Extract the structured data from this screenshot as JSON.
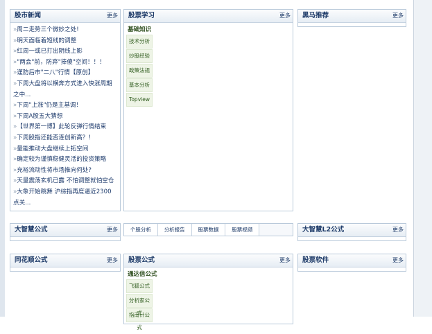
{
  "more_label": "更多",
  "panels": {
    "news": {
      "title": "股市新闻",
      "items": [
        "周二走势三个微妙之处!",
        "明天面临着短线的调整",
        "红周一或已打出阴线上影",
        "\"两会\"前，防弃\"捧傻\"空间！！！",
        "谨防后市\"二八\"行情【原创】",
        "下周大盘将以横奔方式进入快涨周期之中...",
        "下周\"上涨\"仍是主基调！",
        "下周A股五大猜想",
        "【世界第一博】此轮反弹行情结束",
        "下周股指还能否连创新高？！",
        "量能推动大盘继续上拓空间",
        "确定较为谨慎稳健灵活的投资策略",
        "充裕流动性将市场推向何处?",
        "天量震荡玄机已露 不怕调整就怕空仓",
        "大象开始跳舞 沪综指再度逼近2300点关..."
      ]
    },
    "learning": {
      "title": "股票学习",
      "sub_head": "基础知识",
      "items": [
        "技术分析",
        "炒股经验",
        "政策法规",
        "基本分析",
        "Topview"
      ]
    },
    "darkhorse": {
      "title": "黑马推荐"
    },
    "dazhihui": {
      "title": "大智慧公式"
    },
    "dazhihui_l2": {
      "title": "大智慧L2公式"
    },
    "tonghuashun": {
      "title": "同花顺公式"
    },
    "formula": {
      "title": "股票公式",
      "sub_head": "通达信公式",
      "items": [
        "飞狐公式",
        "分析家公式",
        "指南针公式"
      ]
    },
    "software": {
      "title": "股票软件"
    }
  },
  "tabs": [
    "个股分析",
    "分析报告",
    "股票数据",
    "股票视频"
  ]
}
